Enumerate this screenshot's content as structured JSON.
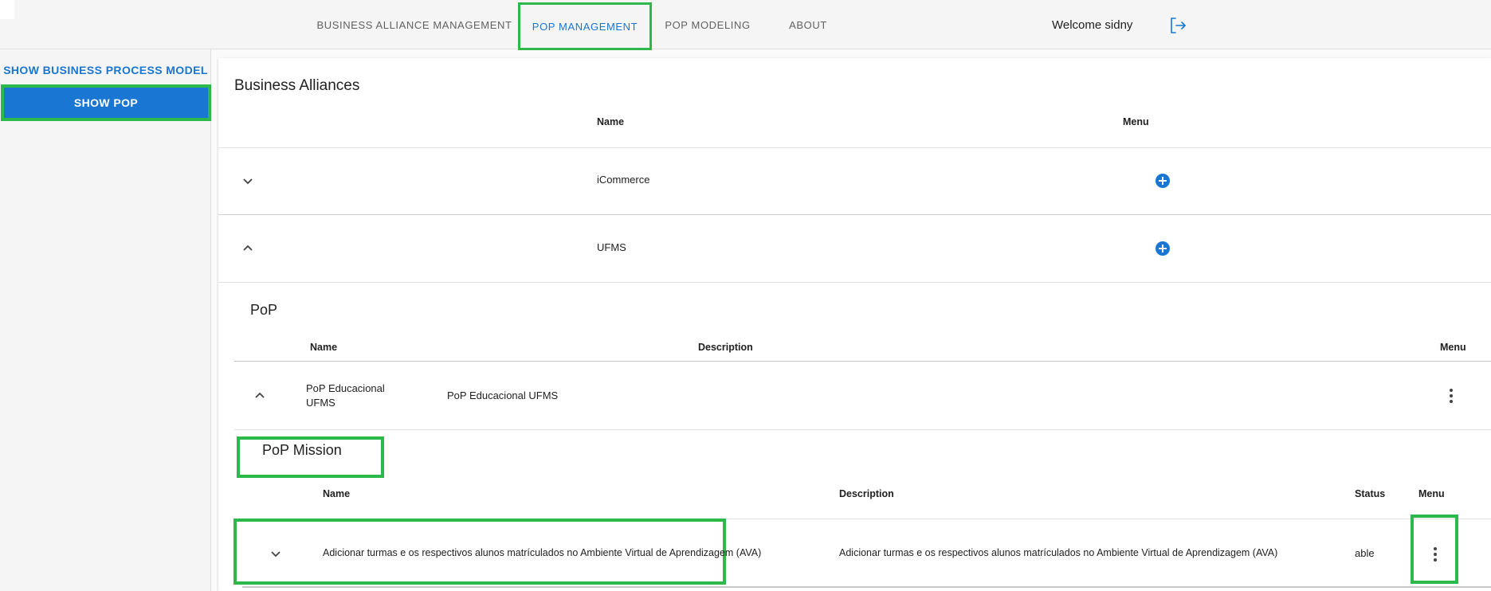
{
  "nav": {
    "items": [
      {
        "label": "BUSINESS ALLIANCE MANAGEMENT"
      },
      {
        "label": "POP MANAGEMENT"
      },
      {
        "label": "POP MODELING"
      },
      {
        "label": "ABOUT"
      }
    ],
    "welcome": "Welcome sidny"
  },
  "sidebar": {
    "link": "SHOW BUSINESS PROCESS MODEL",
    "button": "SHOW POP"
  },
  "alliances": {
    "title": "Business Alliances",
    "headers": {
      "name": "Name",
      "menu": "Menu"
    },
    "rows": [
      {
        "name": "iCommerce"
      },
      {
        "name": "UFMS"
      }
    ]
  },
  "pop": {
    "title": "PoP",
    "headers": {
      "name": "Name",
      "description": "Description",
      "menu": "Menu"
    },
    "row": {
      "name": "PoP Educacional UFMS",
      "description": "PoP Educacional UFMS"
    }
  },
  "mission": {
    "title": "PoP Mission",
    "headers": {
      "name": "Name",
      "description": "Description",
      "status": "Status",
      "menu": "Menu"
    },
    "row": {
      "name": "Adicionar turmas e os respectivos alunos matrículados no Ambiente Virtual de Aprendizagem (AVA)",
      "description": "Adicionar turmas e os respectivos alunos matrículados no Ambiente Virtual de Aprendizagem (AVA)",
      "status": "able"
    }
  },
  "colors": {
    "accent": "#1976d2",
    "highlight": "#2db84b"
  }
}
